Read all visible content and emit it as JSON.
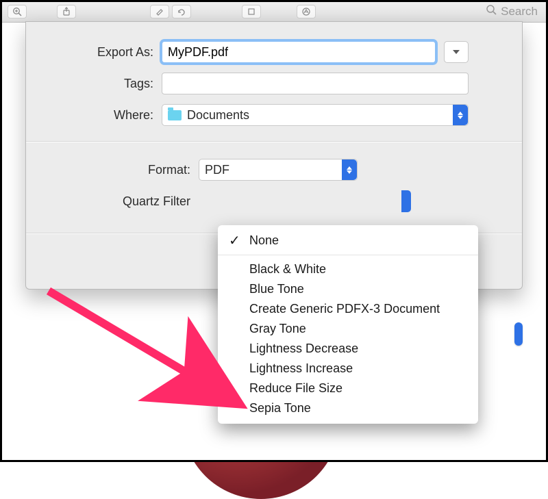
{
  "toolbar": {
    "search_placeholder": "Search"
  },
  "dialog": {
    "export_as_label": "Export As:",
    "filename": "MyPDF.pdf",
    "tags_label": "Tags:",
    "tags_value": "",
    "where_label": "Where:",
    "where_value": "Documents",
    "format_label": "Format:",
    "format_value": "PDF",
    "quartz_filter_label": "Quartz Filter"
  },
  "quartz_menu": {
    "selected": "None",
    "items": [
      "Black & White",
      "Blue Tone",
      "Create Generic PDFX-3 Document",
      "Gray Tone",
      "Lightness Decrease",
      "Lightness Increase",
      "Reduce File Size",
      "Sepia Tone"
    ]
  },
  "annotation": {
    "points_to": "Reduce File Size",
    "arrow_color": "#ff2a68"
  }
}
